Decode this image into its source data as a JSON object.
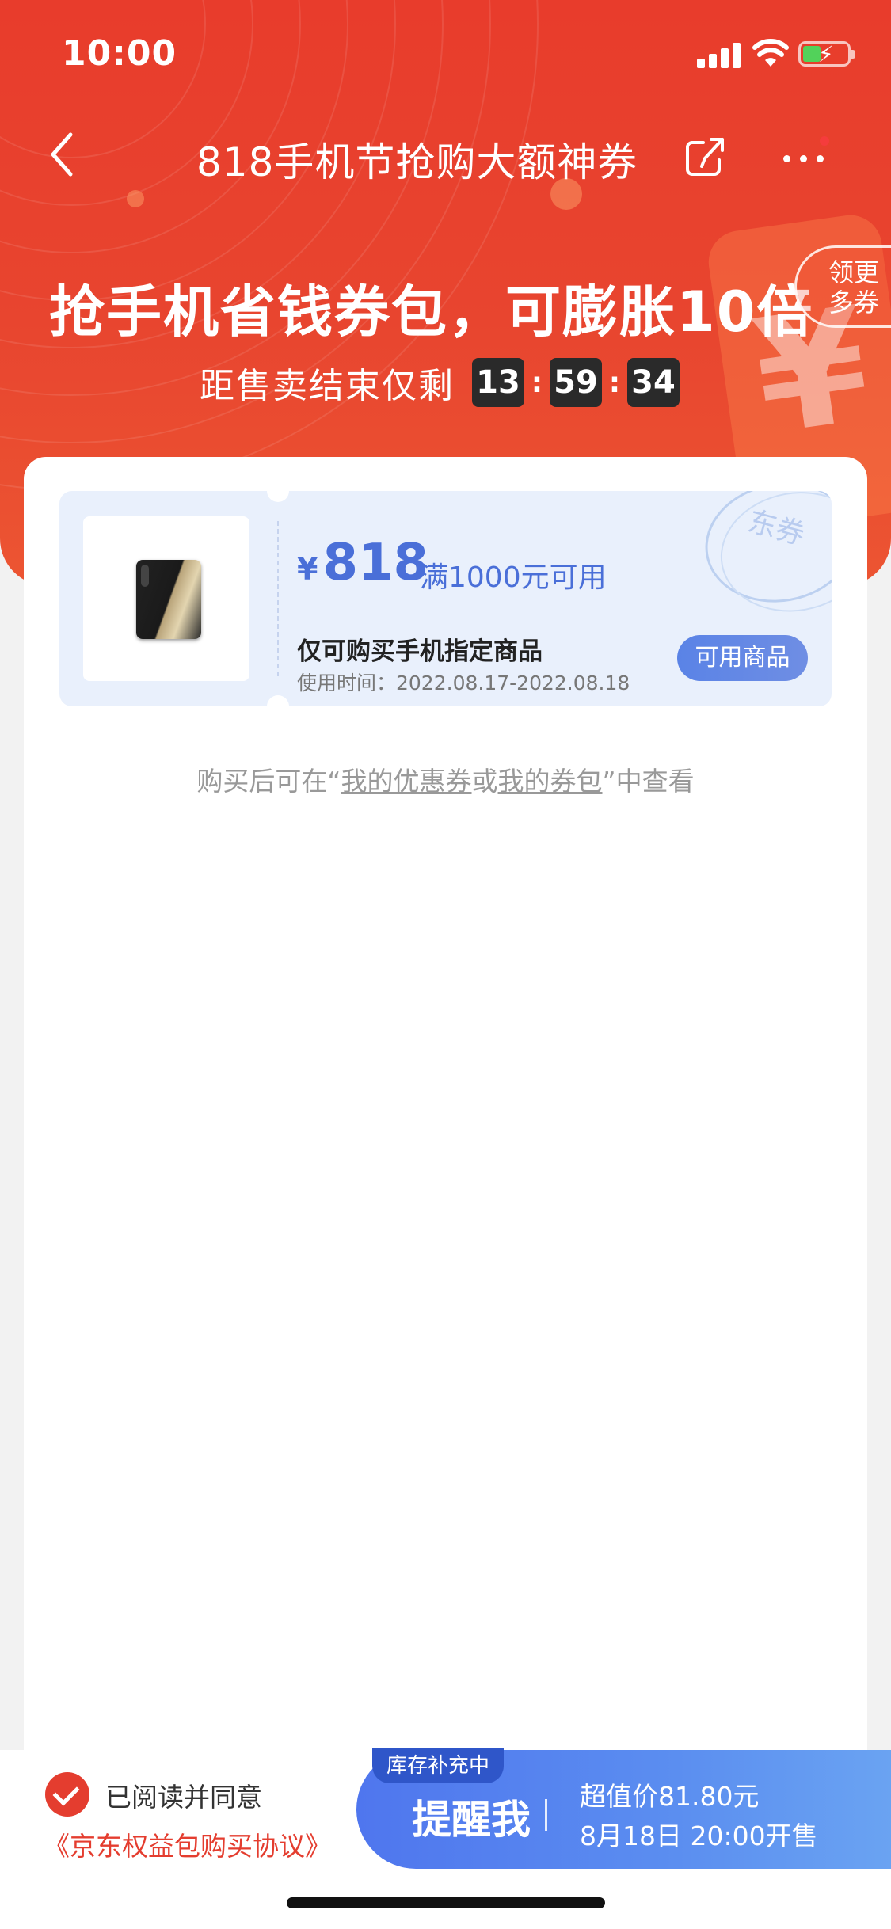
{
  "status_bar": {
    "time": "10:00"
  },
  "nav": {
    "title": "818手机节抢购大额神券"
  },
  "hero": {
    "headline": "抢手机省钱券包，可膨胀10倍",
    "more_coupons": "领更多券",
    "more_coupons_line1": "领更",
    "more_coupons_line2": "多券",
    "countdown_label": "距售卖结束仅剩",
    "countdown": {
      "hours": "13",
      "minutes": "59",
      "seconds": "34",
      "separator": ":"
    }
  },
  "coupon": {
    "currency_symbol": "¥",
    "amount": "818",
    "condition": "满1000元可用",
    "description": "仅可购买手机指定商品",
    "valid_period": "使用时间：2022.08.17-2022.08.18",
    "button_label": "可用商品",
    "stamp_text": "东券"
  },
  "hint": {
    "prefix": "购买后可在“",
    "link1": "我的优惠券",
    "middle": "或",
    "link2": "我的券包",
    "suffix": "”中查看"
  },
  "bottom_bar": {
    "agree_text": "已阅读并同意",
    "agreement_link": "《京东权益包购买协议》",
    "cta_tag": "库存补充中",
    "cta_label": "提醒我",
    "cta_price": "超值价81.80元",
    "cta_sale_time": "8月18日 20:00开售"
  },
  "colors": {
    "brand_red": "#e83c2c",
    "coupon_blue": "#4a6fd8",
    "cta_blue": "#4f76ee"
  }
}
